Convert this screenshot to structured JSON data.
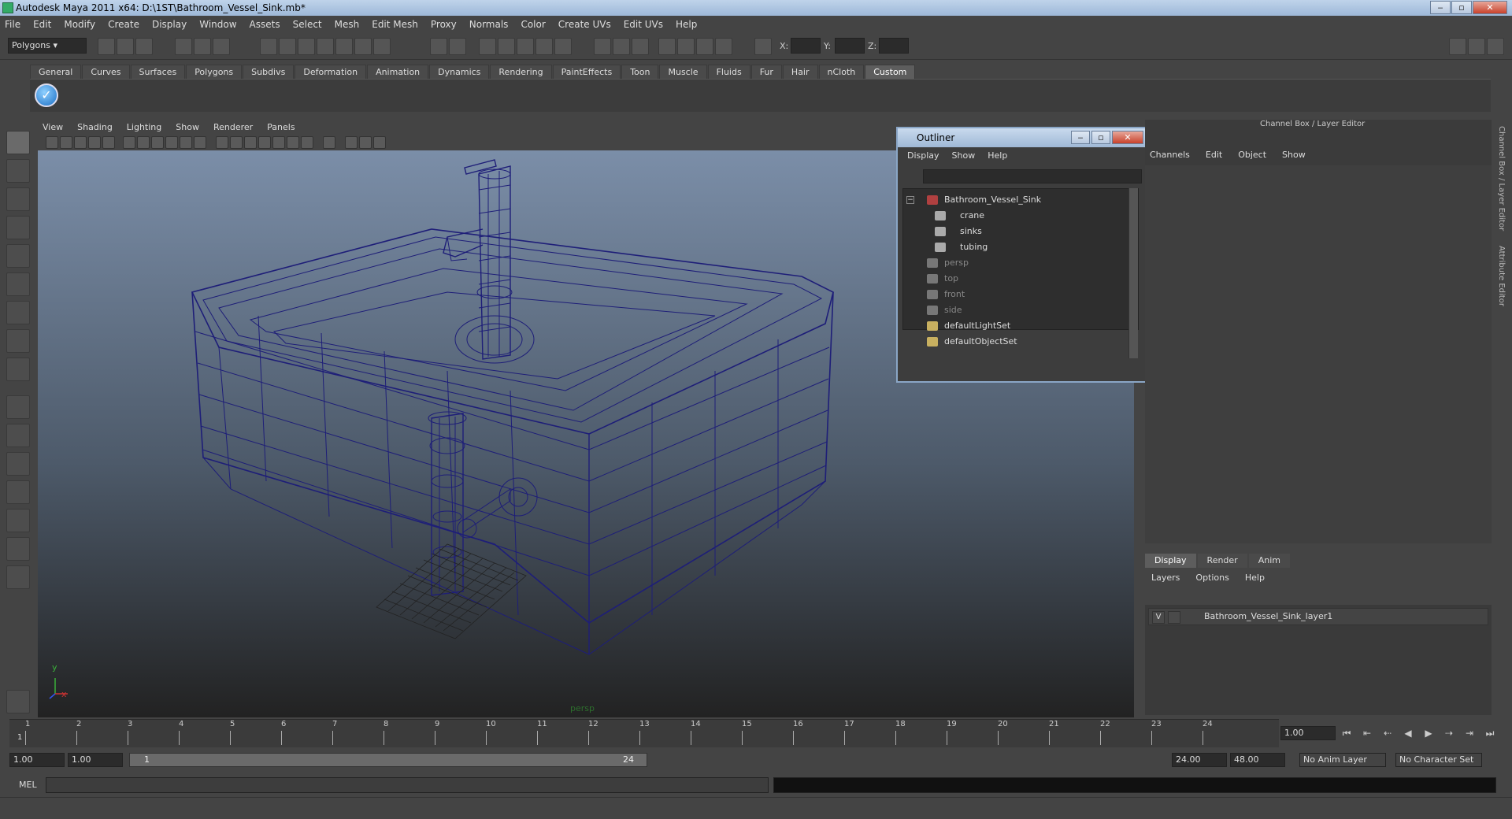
{
  "window": {
    "title": "Autodesk Maya 2011 x64: D:\\1ST\\Bathroom_Vessel_Sink.mb*"
  },
  "menubar": [
    "File",
    "Edit",
    "Modify",
    "Create",
    "Display",
    "Window",
    "Assets",
    "Select",
    "Mesh",
    "Edit Mesh",
    "Proxy",
    "Normals",
    "Color",
    "Create UVs",
    "Edit UVs",
    "Help"
  ],
  "toolbar": {
    "mode": "Polygons",
    "x_label": "X:",
    "y_label": "Y:",
    "z_label": "Z:"
  },
  "shelf_tabs": [
    "General",
    "Curves",
    "Surfaces",
    "Polygons",
    "Subdivs",
    "Deformation",
    "Animation",
    "Dynamics",
    "Rendering",
    "PaintEffects",
    "Toon",
    "Muscle",
    "Fluids",
    "Fur",
    "Hair",
    "nCloth",
    "Custom"
  ],
  "shelf_active": "Custom",
  "panel_menu": [
    "View",
    "Shading",
    "Lighting",
    "Show",
    "Renderer",
    "Panels"
  ],
  "viewport": {
    "camera_label": "persp",
    "axis_x": "x",
    "axis_y": "y"
  },
  "outliner": {
    "title": "Outliner",
    "menu": [
      "Display",
      "Show",
      "Help"
    ],
    "items": [
      {
        "label": "Bathroom_Vessel_Sink",
        "icon": "group-icon",
        "dim": false,
        "indent": 0
      },
      {
        "label": "crane",
        "icon": "mesh-icon",
        "dim": false,
        "indent": 1
      },
      {
        "label": "sinks",
        "icon": "mesh-icon",
        "dim": false,
        "indent": 1
      },
      {
        "label": "tubing",
        "icon": "mesh-icon",
        "dim": false,
        "indent": 1
      },
      {
        "label": "persp",
        "icon": "camera-icon",
        "dim": true,
        "indent": 0
      },
      {
        "label": "top",
        "icon": "camera-icon",
        "dim": true,
        "indent": 0
      },
      {
        "label": "front",
        "icon": "camera-icon",
        "dim": true,
        "indent": 0
      },
      {
        "label": "side",
        "icon": "camera-icon",
        "dim": true,
        "indent": 0
      },
      {
        "label": "defaultLightSet",
        "icon": "set-icon",
        "dim": false,
        "indent": 0
      },
      {
        "label": "defaultObjectSet",
        "icon": "set-icon",
        "dim": false,
        "indent": 0
      }
    ]
  },
  "channel_box": {
    "title": "Channel Box / Layer Editor",
    "menu": [
      "Channels",
      "Edit",
      "Object",
      "Show"
    ]
  },
  "layer_editor": {
    "tabs": [
      "Display",
      "Render",
      "Anim"
    ],
    "active_tab": "Display",
    "menu": [
      "Layers",
      "Options",
      "Help"
    ],
    "layer": {
      "visible": "V",
      "name": "Bathroom_Vessel_Sink_layer1"
    }
  },
  "side_tabs": [
    "Channel Box / Layer Editor",
    "Attribute Editor"
  ],
  "timeline": {
    "ticks": [
      "1",
      "2",
      "3",
      "4",
      "5",
      "6",
      "7",
      "8",
      "9",
      "10",
      "11",
      "12",
      "13",
      "14",
      "15",
      "16",
      "17",
      "18",
      "19",
      "20",
      "21",
      "22",
      "23",
      "24"
    ],
    "current_frame": "1",
    "frame_field": "1.00"
  },
  "range": {
    "start": "1.00",
    "playback_start": "1.00",
    "slider_start": "1",
    "slider_end": "24",
    "playback_end": "24.00",
    "end": "48.00",
    "anim_layer": "No Anim Layer",
    "character_set": "No Character Set"
  },
  "command_line": {
    "label": "MEL"
  },
  "colors": {
    "wireframe": "#1e1e78",
    "viewport_top": "#7b8ea8",
    "viewport_bottom": "#222222"
  }
}
